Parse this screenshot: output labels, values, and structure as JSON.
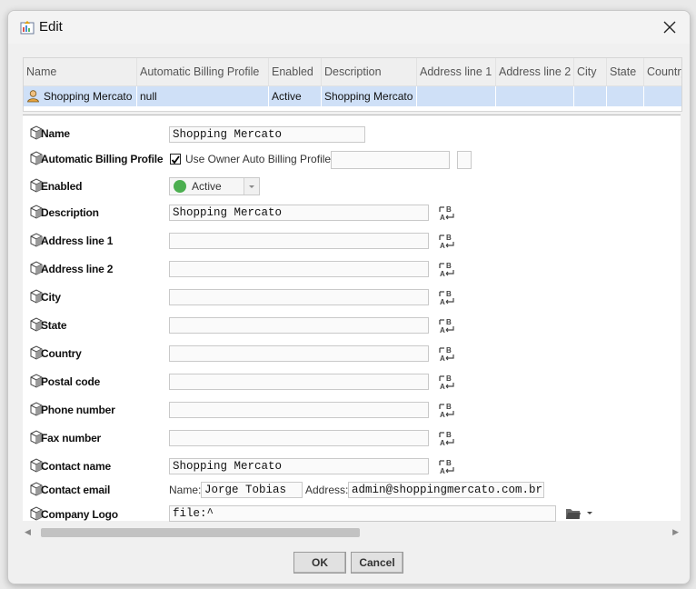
{
  "window": {
    "title": "Edit"
  },
  "table": {
    "columns": [
      "Name",
      "Automatic Billing Profile",
      "Enabled",
      "Description",
      "Address line 1",
      "Address line 2",
      "City",
      "State",
      "Country"
    ],
    "row": [
      "Shopping Mercato",
      "null",
      "Active",
      "Shopping Mercato",
      "",
      "",
      "",
      "",
      ""
    ]
  },
  "form": {
    "name": {
      "label": "Name",
      "value": "Shopping Mercato"
    },
    "billing": {
      "label": "Automatic Billing Profile",
      "checkbox_label": "Use Owner Auto Billing Profile",
      "checked": true,
      "value": ""
    },
    "enabled": {
      "label": "Enabled",
      "value": "Active",
      "status_color": "#4caf50"
    },
    "description": {
      "label": "Description",
      "value": "Shopping Mercato"
    },
    "address1": {
      "label": "Address line 1",
      "value": ""
    },
    "address2": {
      "label": "Address line 2",
      "value": ""
    },
    "city": {
      "label": "City",
      "value": ""
    },
    "state": {
      "label": "State",
      "value": ""
    },
    "country": {
      "label": "Country",
      "value": ""
    },
    "postal": {
      "label": "Postal code",
      "value": ""
    },
    "phone": {
      "label": "Phone number",
      "value": ""
    },
    "fax": {
      "label": "Fax number",
      "value": ""
    },
    "contact_name": {
      "label": "Contact name",
      "value": "Shopping Mercato"
    },
    "contact_email": {
      "label": "Contact email",
      "name_label": "Name:",
      "name_value": "Jorge Tobias",
      "address_label": "Address:",
      "address_value": "admin@shoppingmercato.com.br"
    },
    "logo": {
      "label": "Company Logo",
      "value": "file:^"
    }
  },
  "buttons": {
    "ok": "OK",
    "cancel": "Cancel"
  },
  "icons": {
    "app": "app-icon",
    "close": "close-icon",
    "property": "property-icon",
    "format": "text-format-icon",
    "folder": "folder-icon",
    "user": "user-icon",
    "dropdown": "chevron-down-icon"
  }
}
